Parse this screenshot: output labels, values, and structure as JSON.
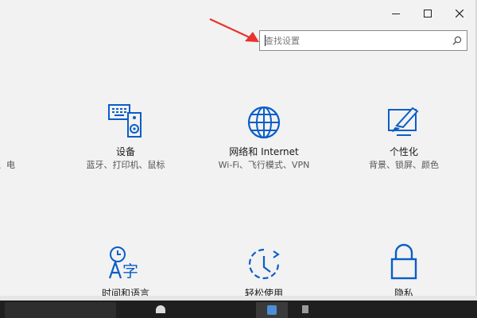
{
  "window": {
    "controls": {
      "minimize": "–",
      "maximize": "□",
      "close": "×"
    }
  },
  "search": {
    "placeholder": "查找设置"
  },
  "colors": {
    "accent": "#0a5ec7",
    "annotation_arrow": "#e8332f"
  },
  "tiles": [
    {
      "title": "",
      "desc": "用、电",
      "icon": "system-icon"
    },
    {
      "title": "设备",
      "desc": "蓝牙、打印机、鼠标",
      "icon": "devices-icon"
    },
    {
      "title": "网络和 Internet",
      "desc": "Wi-Fi、飞行模式、VPN",
      "icon": "globe-icon"
    },
    {
      "title": "个性化",
      "desc": "背景、锁屏、颜色",
      "icon": "personalization-icon"
    },
    {
      "title": "时间和语言",
      "desc": "",
      "icon": "time-language-icon"
    },
    {
      "title": "轻松使用",
      "desc": "",
      "icon": "ease-of-access-icon"
    },
    {
      "title": "隐私",
      "desc": "",
      "icon": "lock-icon"
    }
  ]
}
